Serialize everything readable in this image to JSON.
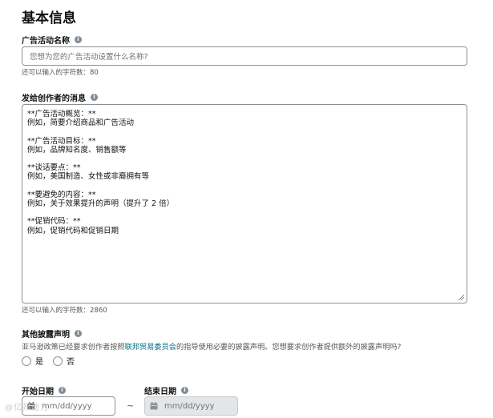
{
  "section": {
    "title": "基本信息"
  },
  "campaign_name": {
    "label": "广告活动名称",
    "placeholder": "您想为您的广告活动设置什么名称?",
    "counter": "还可以输入的字符数：80"
  },
  "creator_message": {
    "label": "发给创作者的消息",
    "content": "**广告活动概览：**\n例如，简要介绍商品和广告活动\n\n**广告活动目标：**\n例如，品牌知名度、销售额等\n\n**谈话要点：**\n例如，美国制造、女性或非裔拥有等\n\n**要避免的内容：**\n例如，关于效果提升的声明（提升了 2 倍）\n\n**促销代码：**\n例如，促销代码和促销日期",
    "counter": "还可以输入的字符数：2860"
  },
  "disclosure": {
    "label": "其他披露声明",
    "desc_before": "亚马逊政策已经要求创作者按照",
    "desc_link": "联邦贸易委员会",
    "desc_after": "的指导使用必要的披露声明。您想要求创作者提供额外的披露声明吗?",
    "options": [
      "是",
      "否"
    ]
  },
  "dates": {
    "start_label": "开始日期",
    "end_label": "结束日期",
    "start_placeholder": "mm/dd/yyyy",
    "end_placeholder": "mm/dd/yyyy",
    "separator": "~"
  },
  "icons": {
    "info": "info-icon",
    "calendar": "calendar-icon",
    "resize": "resize-grip-icon"
  },
  "watermark": "@亿邦动力"
}
